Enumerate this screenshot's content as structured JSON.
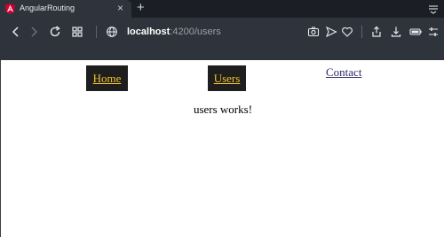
{
  "browser": {
    "tab": {
      "title": "AngularRouting",
      "favicon": "angular-icon",
      "favicon_color": "#dd0031"
    },
    "address": {
      "host": "localhost",
      "path": ":4200/users"
    },
    "colors": {
      "tabbar": "#1b1e24",
      "toolbar": "#2f343c"
    }
  },
  "nav": {
    "home_label": "Home",
    "users_label": "Users",
    "contact_label": "Contact",
    "button_bg": "#1e1e1e",
    "button_text": "#f2c230"
  },
  "main": {
    "message": "users works!"
  }
}
